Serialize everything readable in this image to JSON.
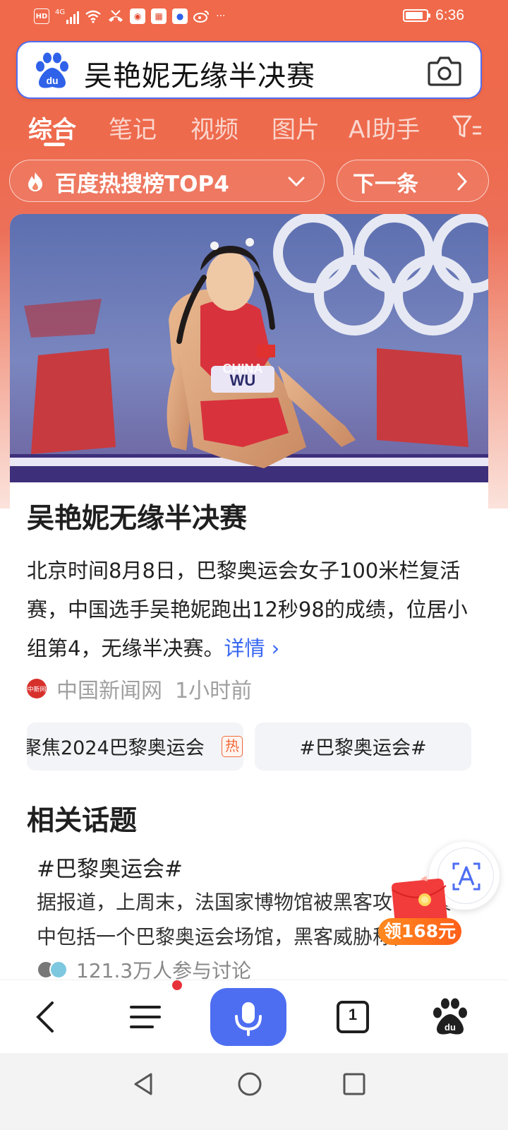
{
  "status_bar": {
    "left_icons": [
      "hd-icon",
      "signal-icon",
      "wifi-icon",
      "missed-call-icon",
      "weibo-icon",
      "calendar-icon",
      "baidu-icon",
      "weibo-icon",
      "more-icon"
    ],
    "hd_label": "HD",
    "network_label": "4G",
    "more": "···",
    "time": "6:36"
  },
  "search": {
    "query": "吴艳妮无缘半决赛",
    "logo": "baidu-paw-icon",
    "camera": "camera-icon"
  },
  "tabs": [
    {
      "label": "综合",
      "active": true
    },
    {
      "label": "笔记",
      "active": false
    },
    {
      "label": "视频",
      "active": false
    },
    {
      "label": "图片",
      "active": false
    },
    {
      "label": "AI助手",
      "active": false
    }
  ],
  "hot": {
    "label": "百度热搜榜TOP4",
    "next_label": "下一条"
  },
  "article": {
    "title": "吴艳妮无缘半决赛",
    "body": "北京时间8月8日，巴黎奥运会女子100米栏复活赛，中国选手吴艳妮跑出12秒98的成绩，位居小组第4，无缘半决赛。",
    "more_label": "详情 ›",
    "source": "中国新闻网",
    "time": "1小时前",
    "source_logo_text": "中新网",
    "image_bib": "WU",
    "image_jersey": "CHINA"
  },
  "chips": [
    {
      "label": "聚焦2024巴黎奥运会",
      "tag": "热"
    },
    {
      "label": "#巴黎奥运会#"
    }
  ],
  "related": {
    "section_title": "相关话题",
    "topic_title": "#巴黎奥运会#",
    "topic_body": "据报道，上周末，法国家博物馆被黑客攻击，其中包括一个巴黎奥运会场馆，黑客威胁称，",
    "participants": "121.3万人参与讨论"
  },
  "floating": {
    "translate": "translate-icon",
    "redpacket_label": "领168元"
  },
  "bottom_nav": {
    "tab_count": "1"
  },
  "colors": {
    "accent": "#4e6ef2",
    "header_orange": "#ee6a4c",
    "link": "#3867f1",
    "hot_tag": "#f26a3a"
  }
}
